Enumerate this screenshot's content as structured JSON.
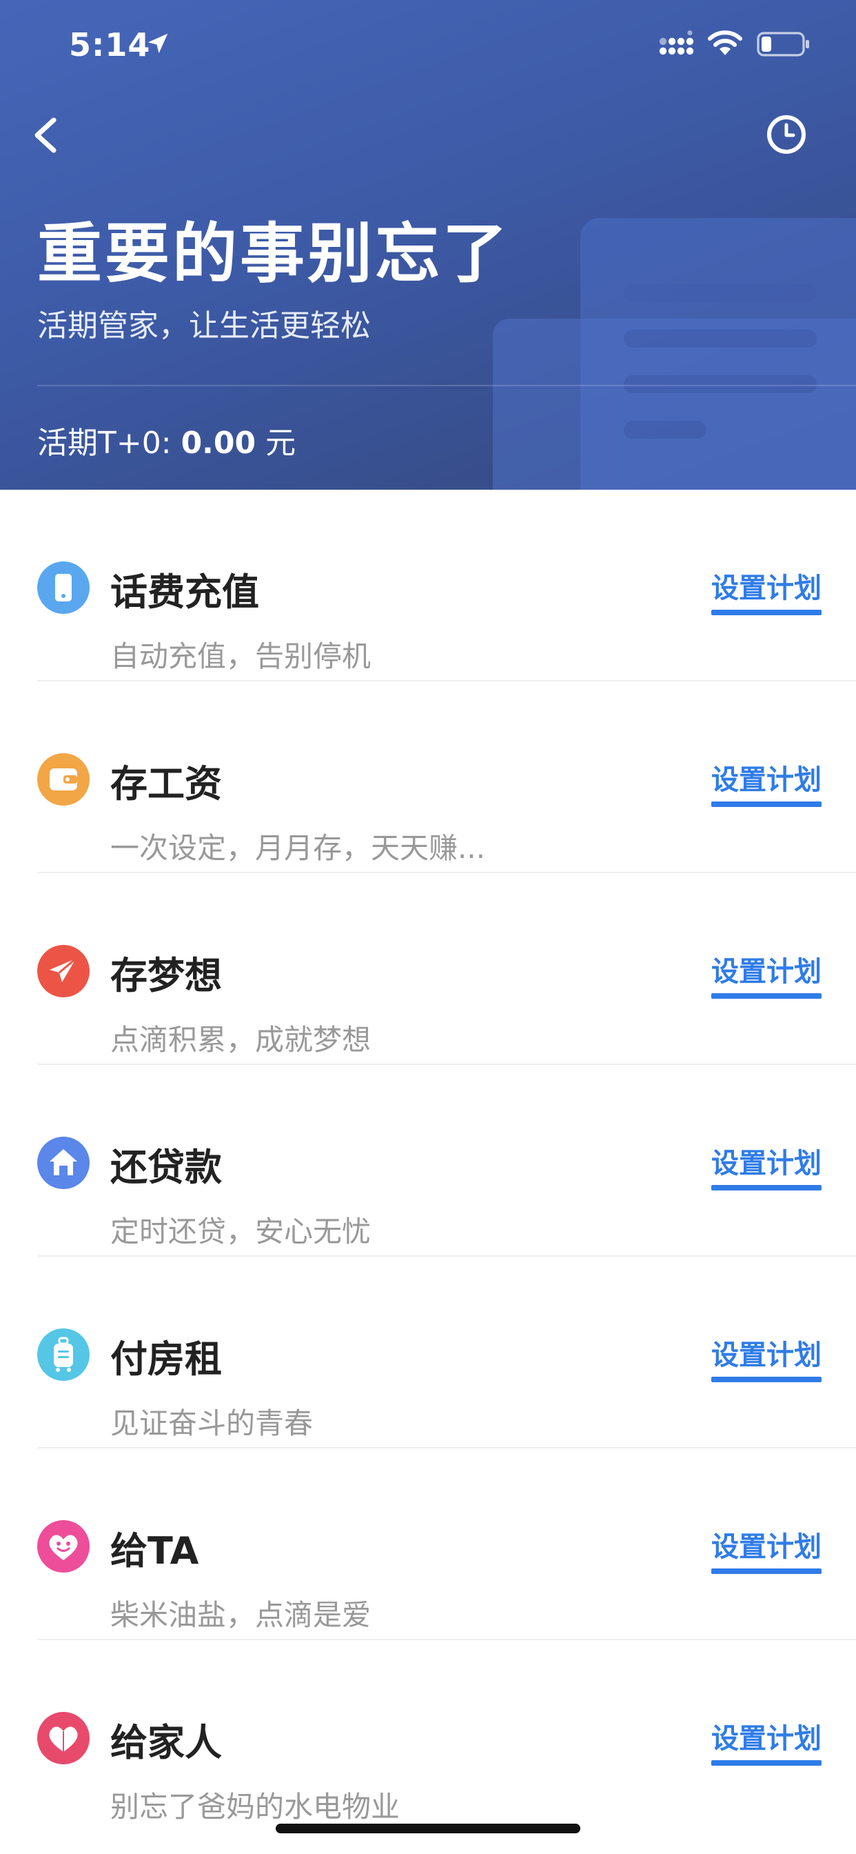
{
  "status_bar": {
    "time": "5:14"
  },
  "header": {
    "title": "重要的事别忘了",
    "subtitle": "活期管家，让生活更轻松",
    "balance_label": "活期T+0: ",
    "balance_amount": "0.00",
    "balance_unit": " 元"
  },
  "items": [
    {
      "name": "话费充值",
      "desc": "自动充值，告别停机",
      "action": "设置计划",
      "icon": "phone-icon",
      "color": "#5aa7f0"
    },
    {
      "name": "存工资",
      "desc": "一次设定，月月存，天天赚...",
      "action": "设置计划",
      "icon": "wallet-icon",
      "color": "#f2a646"
    },
    {
      "name": "存梦想",
      "desc": "点滴积累，成就梦想",
      "action": "设置计划",
      "icon": "paper-plane-icon",
      "color": "#ec5545"
    },
    {
      "name": "还贷款",
      "desc": "定时还贷，安心无忧",
      "action": "设置计划",
      "icon": "house-icon",
      "color": "#5b86ea"
    },
    {
      "name": "付房租",
      "desc": "见证奋斗的青春",
      "action": "设置计划",
      "icon": "luggage-icon",
      "color": "#55c6e6"
    },
    {
      "name": "给TA",
      "desc": "柴米油盐，点滴是爱",
      "action": "设置计划",
      "icon": "smiley-heart-icon",
      "color": "#ee4d9a"
    },
    {
      "name": "给家人",
      "desc": "别忘了爸妈的水电物业",
      "action": "设置计划",
      "icon": "heart-icon",
      "color": "#e84a6c"
    }
  ]
}
